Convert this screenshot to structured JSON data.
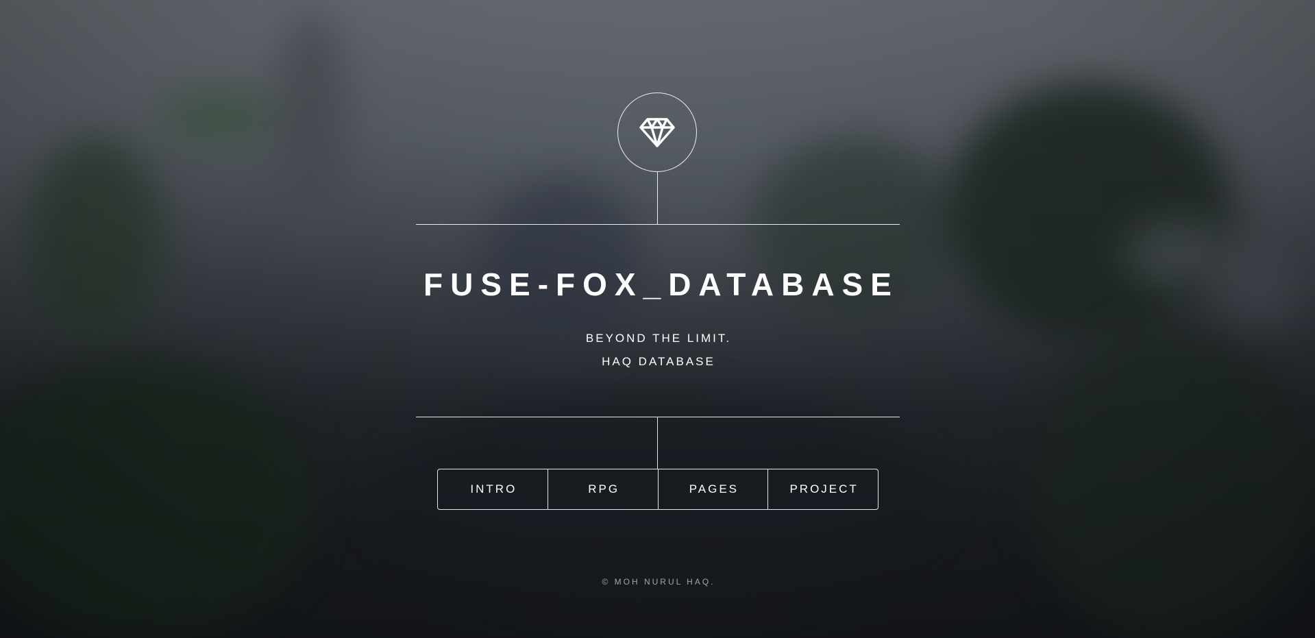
{
  "site": {
    "title": "FUSE-FOX_DATABASE",
    "tagline_line1": "BEYOND THE LIMIT.",
    "tagline_line2": "HAQ DATABASE",
    "logo_icon": "diamond-icon"
  },
  "nav": {
    "items": [
      {
        "label": "INTRO"
      },
      {
        "label": "RPG"
      },
      {
        "label": "PAGES"
      },
      {
        "label": "PROJECT"
      }
    ]
  },
  "footer": {
    "copyright": "© MOH NURUL HAQ."
  },
  "colors": {
    "text": "#ffffff",
    "background_dark": "#181b20",
    "background_light": "#6f747b"
  }
}
